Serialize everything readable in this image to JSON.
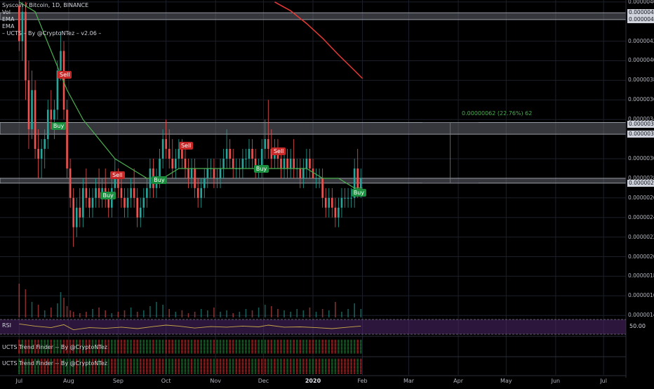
{
  "legend": {
    "title": "Syscoin / Bitcoin, 1D, BINANCE",
    "lines": [
      "Vol",
      "EMA",
      "EMA",
      "– UCTS – By @CryptoNTez – v2.06 –"
    ]
  },
  "panes": {
    "rsi_title": "RSI",
    "rsi_value": "50.00",
    "trend1_title": "UCTS Trend Finder -- By @CryptoNTez",
    "trend2_title": "UCTS Trend Finder -- By @CryptoNTez"
  },
  "measure_label": "0.00000062 (22.76%) 62",
  "colors": {
    "up": "#26a69a",
    "down": "#ef5350",
    "ema_fast": "#4caf50",
    "ema_slow": "#e53935",
    "rsi": "#c9a94a",
    "background": "#000000"
  },
  "chart_data": {
    "type": "candlestick",
    "title": "Syscoin / Bitcoin, 1D, BINANCE",
    "y_tick_labels": [
      "0.00000460",
      "0.00000442",
      "0.00000420",
      "0.00000400",
      "0.00000380",
      "0.00000360",
      "0.00000340",
      "0.00000325",
      "0.00000300",
      "0.00000280",
      "0.00000260",
      "0.00000240",
      "0.00000220",
      "0.00000200",
      "0.00000180",
      "0.00000160",
      "0.00000140"
    ],
    "y_ticks": [
      4.6e-06,
      4.42e-06,
      4.2e-06,
      4e-06,
      3.8e-06,
      3.6e-06,
      3.4e-06,
      3.25e-06,
      3e-06,
      2.8e-06,
      2.6e-06,
      2.4e-06,
      2.2e-06,
      2e-06,
      1.8e-06,
      1.6e-06,
      1.4e-06
    ],
    "price_labels": [
      {
        "text": "0.00000449",
        "value": 4.49e-06
      },
      {
        "text": "0.00000442",
        "value": 4.42e-06
      },
      {
        "text": "0.00000335",
        "value": 3.35e-06
      },
      {
        "text": "0.00000325",
        "value": 3.25e-06
      },
      {
        "text": "0.00000275",
        "value": 2.75e-06
      }
    ],
    "ylim": [
      1.38e-06,
      4.62e-06
    ],
    "x_labels": [
      {
        "text": "Jul",
        "day": 0
      },
      {
        "text": "Aug",
        "day": 31
      },
      {
        "text": "Sep",
        "day": 62
      },
      {
        "text": "Oct",
        "day": 92
      },
      {
        "text": "Nov",
        "day": 123
      },
      {
        "text": "Dec",
        "day": 153
      },
      {
        "text": "2020",
        "day": 184,
        "bold": true
      },
      {
        "text": "Feb",
        "day": 215
      },
      {
        "text": "Mar",
        "day": 244
      },
      {
        "text": "Apr",
        "day": 275
      },
      {
        "text": "May",
        "day": 305
      },
      {
        "text": "Jun",
        "day": 336
      },
      {
        "text": "Jul",
        "day": 366
      }
    ],
    "xlim": [
      -12,
      380
    ],
    "zones": [
      {
        "low": 4.42e-06,
        "high": 4.49e-06
      },
      {
        "low": 3.25e-06,
        "high": 3.37e-06
      },
      {
        "low": 2.75e-06,
        "high": 2.8e-06
      }
    ],
    "signals": [
      {
        "text": "Sell",
        "day": 28,
        "value": 3.85e-06,
        "kind": "sell"
      },
      {
        "text": "Buy",
        "day": 24,
        "value": 3.33e-06,
        "kind": "buy"
      },
      {
        "text": "Sell",
        "day": 61,
        "value": 2.83e-06,
        "kind": "sell"
      },
      {
        "text": "Buy",
        "day": 55,
        "value": 2.62e-06,
        "kind": "buy"
      },
      {
        "text": "Buy",
        "day": 87,
        "value": 2.78e-06,
        "kind": "buy"
      },
      {
        "text": "Sell",
        "day": 104,
        "value": 3.13e-06,
        "kind": "sell"
      },
      {
        "text": "Buy",
        "day": 151,
        "value": 2.89e-06,
        "kind": "buy"
      },
      {
        "text": "Sell",
        "day": 162,
        "value": 3.07e-06,
        "kind": "sell"
      },
      {
        "text": "Buy",
        "day": 212,
        "value": 2.65e-06,
        "kind": "buy"
      }
    ],
    "measure": {
      "day": 270,
      "from": 2.75e-06,
      "to": 3.37e-06
    },
    "ema_fast": [
      [
        0,
        4.6e-06
      ],
      [
        10,
        4.5e-06
      ],
      [
        20,
        4.1e-06
      ],
      [
        30,
        3.7e-06
      ],
      [
        40,
        3.4e-06
      ],
      [
        50,
        3.2e-06
      ],
      [
        60,
        3e-06
      ],
      [
        70,
        2.9e-06
      ],
      [
        80,
        2.8e-06
      ],
      [
        90,
        2.8e-06
      ],
      [
        100,
        2.9e-06
      ],
      [
        110,
        2.9e-06
      ],
      [
        120,
        2.9e-06
      ],
      [
        130,
        2.9e-06
      ],
      [
        140,
        2.9e-06
      ],
      [
        150,
        2.9e-06
      ],
      [
        160,
        2.9e-06
      ],
      [
        170,
        2.9e-06
      ],
      [
        180,
        2.9e-06
      ],
      [
        190,
        2.8e-06
      ],
      [
        200,
        2.8e-06
      ],
      [
        210,
        2.7e-06
      ],
      [
        215,
        2.7e-06
      ]
    ],
    "ema_slow": [
      [
        160,
        4.6e-06
      ],
      [
        170,
        4.51e-06
      ],
      [
        180,
        4.38e-06
      ],
      [
        190,
        4.23e-06
      ],
      [
        200,
        4.06e-06
      ],
      [
        210,
        3.9e-06
      ],
      [
        215,
        3.82e-06
      ]
    ],
    "candles": [
      [
        0,
        4.56e-06,
        4.62e-06,
        4.1e-06,
        4.2e-06
      ],
      [
        2,
        4.2e-06,
        4.6e-06,
        4e-06,
        4.5e-06
      ],
      [
        4,
        4.5e-06,
        4.6e-06,
        3.6e-06,
        3.8e-06
      ],
      [
        6,
        3.8e-06,
        4e-06,
        3.1e-06,
        3.3e-06
      ],
      [
        8,
        3.3e-06,
        3.9e-06,
        3.2e-06,
        3.7e-06
      ],
      [
        10,
        3.7e-06,
        3.8e-06,
        3e-06,
        3.1e-06
      ],
      [
        12,
        3.1e-06,
        3.3e-06,
        2.8e-06,
        3e-06
      ],
      [
        14,
        3e-06,
        3.2e-06,
        2.8e-06,
        3.1e-06
      ],
      [
        16,
        3.1e-06,
        3.3e-06,
        2.9e-06,
        3.2e-06
      ],
      [
        18,
        3.2e-06,
        3.6e-06,
        3.1e-06,
        3.5e-06
      ],
      [
        20,
        3.5e-06,
        3.7e-06,
        3.3e-06,
        3.4e-06
      ],
      [
        22,
        3.4e-06,
        3.6e-06,
        3.2e-06,
        3.5e-06
      ],
      [
        24,
        3.5e-06,
        4e-06,
        3.4e-06,
        3.9e-06
      ],
      [
        26,
        3.9e-06,
        4.3e-06,
        3.8e-06,
        4.1e-06
      ],
      [
        28,
        4.1e-06,
        4.2e-06,
        3.4e-06,
        3.5e-06
      ],
      [
        30,
        3.5e-06,
        3.6e-06,
        2.8e-06,
        2.9e-06
      ],
      [
        32,
        2.9e-06,
        3e-06,
        2.5e-06,
        2.6e-06
      ],
      [
        34,
        2.6e-06,
        2.7e-06,
        2.1e-06,
        2.3e-06
      ],
      [
        36,
        2.3e-06,
        2.6e-06,
        2.2e-06,
        2.5e-06
      ],
      [
        38,
        2.5e-06,
        2.7e-06,
        2.3e-06,
        2.4e-06
      ],
      [
        40,
        2.4e-06,
        2.8e-06,
        2.3e-06,
        2.7e-06
      ],
      [
        42,
        2.7e-06,
        2.9e-06,
        2.5e-06,
        2.6e-06
      ],
      [
        44,
        2.6e-06,
        2.7e-06,
        2.4e-06,
        2.5e-06
      ],
      [
        46,
        2.5e-06,
        2.7e-06,
        2.4e-06,
        2.6e-06
      ],
      [
        48,
        2.6e-06,
        2.8e-06,
        2.5e-06,
        2.7e-06
      ],
      [
        50,
        2.7e-06,
        2.9e-06,
        2.5e-06,
        2.6e-06
      ],
      [
        52,
        2.6e-06,
        2.8e-06,
        2.5e-06,
        2.7e-06
      ],
      [
        54,
        2.7e-06,
        2.9e-06,
        2.5e-06,
        2.6e-06
      ],
      [
        56,
        2.6e-06,
        2.7e-06,
        2.4e-06,
        2.5e-06
      ],
      [
        58,
        2.5e-06,
        2.8e-06,
        2.4e-06,
        2.7e-06
      ],
      [
        60,
        2.7e-06,
        3e-06,
        2.6e-06,
        2.8e-06
      ],
      [
        62,
        2.8e-06,
        2.9e-06,
        2.6e-06,
        2.7e-06
      ],
      [
        64,
        2.7e-06,
        2.8e-06,
        2.5e-06,
        2.6e-06
      ],
      [
        66,
        2.6e-06,
        2.7e-06,
        2.4e-06,
        2.5e-06
      ],
      [
        68,
        2.5e-06,
        2.7e-06,
        2.4e-06,
        2.6e-06
      ],
      [
        70,
        2.6e-06,
        2.8e-06,
        2.5e-06,
        2.7e-06
      ],
      [
        72,
        2.7e-06,
        2.9e-06,
        2.5e-06,
        2.6e-06
      ],
      [
        74,
        2.6e-06,
        2.7e-06,
        2.3e-06,
        2.4e-06
      ],
      [
        76,
        2.4e-06,
        2.6e-06,
        2.3e-06,
        2.5e-06
      ],
      [
        78,
        2.5e-06,
        2.7e-06,
        2.4e-06,
        2.6e-06
      ],
      [
        80,
        2.6e-06,
        2.8e-06,
        2.5e-06,
        2.7e-06
      ],
      [
        82,
        2.7e-06,
        3e-06,
        2.6e-06,
        2.9e-06
      ],
      [
        84,
        2.9e-06,
        3e-06,
        2.6e-06,
        2.7e-06
      ],
      [
        86,
        2.7e-06,
        2.9e-06,
        2.6e-06,
        2.8e-06
      ],
      [
        88,
        2.8e-06,
        3.1e-06,
        2.7e-06,
        3e-06
      ],
      [
        90,
        3e-06,
        3.3e-06,
        2.9e-06,
        3.2e-06
      ],
      [
        92,
        3.2e-06,
        3.4e-06,
        3e-06,
        3.1e-06
      ],
      [
        94,
        3.1e-06,
        3.3e-06,
        2.9e-06,
        3e-06
      ],
      [
        96,
        3e-06,
        3.2e-06,
        2.8e-06,
        2.9e-06
      ],
      [
        98,
        2.9e-06,
        3.1e-06,
        2.8e-06,
        3e-06
      ],
      [
        100,
        3e-06,
        3.2e-06,
        2.9e-06,
        3.1e-06
      ],
      [
        102,
        3.1e-06,
        3.2e-06,
        2.9e-06,
        3e-06
      ],
      [
        104,
        3e-06,
        3.1e-06,
        2.8e-06,
        2.9e-06
      ],
      [
        106,
        2.9e-06,
        3e-06,
        2.7e-06,
        2.8e-06
      ],
      [
        108,
        2.8e-06,
        3e-06,
        2.7e-06,
        2.9e-06
      ],
      [
        110,
        2.9e-06,
        3e-06,
        2.6e-06,
        2.7e-06
      ],
      [
        112,
        2.7e-06,
        2.8e-06,
        2.5e-06,
        2.6e-06
      ],
      [
        114,
        2.6e-06,
        2.8e-06,
        2.5e-06,
        2.7e-06
      ],
      [
        116,
        2.7e-06,
        2.9e-06,
        2.6e-06,
        2.8e-06
      ],
      [
        118,
        2.8e-06,
        3e-06,
        2.7e-06,
        2.9e-06
      ],
      [
        120,
        2.9e-06,
        3e-06,
        2.8e-06,
        2.9e-06
      ],
      [
        122,
        2.9e-06,
        3e-06,
        2.7e-06,
        2.8e-06
      ],
      [
        124,
        2.8e-06,
        2.9e-06,
        2.7e-06,
        2.8e-06
      ],
      [
        126,
        2.8e-06,
        3e-06,
        2.7e-06,
        2.9e-06
      ],
      [
        128,
        2.9e-06,
        3.1e-06,
        2.8e-06,
        3e-06
      ],
      [
        130,
        3e-06,
        3.3e-06,
        2.9e-06,
        3.1e-06
      ],
      [
        132,
        3.1e-06,
        3.2e-06,
        2.9e-06,
        3e-06
      ],
      [
        134,
        3e-06,
        3.1e-06,
        2.8e-06,
        2.9e-06
      ],
      [
        136,
        2.9e-06,
        3e-06,
        2.8e-06,
        2.9e-06
      ],
      [
        138,
        2.9e-06,
        3e-06,
        2.8e-06,
        2.9e-06
      ],
      [
        140,
        2.9e-06,
        3.1e-06,
        2.8e-06,
        3e-06
      ],
      [
        142,
        3e-06,
        3.1e-06,
        2.9e-06,
        3e-06
      ],
      [
        144,
        3e-06,
        3.2e-06,
        2.9e-06,
        3.1e-06
      ],
      [
        146,
        3.1e-06,
        3.2e-06,
        2.9e-06,
        3e-06
      ],
      [
        148,
        3e-06,
        3.1e-06,
        2.8e-06,
        2.9e-06
      ],
      [
        150,
        2.9e-06,
        3e-06,
        2.8e-06,
        2.9e-06
      ],
      [
        152,
        2.9e-06,
        3.2e-06,
        2.8e-06,
        3.1e-06
      ],
      [
        154,
        3.1e-06,
        3.4e-06,
        3e-06,
        3.2e-06
      ],
      [
        156,
        3.2e-06,
        3.6e-06,
        3e-06,
        3.1e-06
      ],
      [
        158,
        3.1e-06,
        3.3e-06,
        2.9e-06,
        3e-06
      ],
      [
        160,
        3e-06,
        3.2e-06,
        2.9e-06,
        3.1e-06
      ],
      [
        162,
        3.1e-06,
        3.2e-06,
        2.9e-06,
        3e-06
      ],
      [
        164,
        3e-06,
        3.1e-06,
        2.8e-06,
        2.9e-06
      ],
      [
        166,
        2.9e-06,
        3.1e-06,
        2.8e-06,
        3e-06
      ],
      [
        168,
        3e-06,
        3.1e-06,
        2.8e-06,
        2.9e-06
      ],
      [
        170,
        2.9e-06,
        3.1e-06,
        2.8e-06,
        3e-06
      ],
      [
        172,
        3e-06,
        3.2e-06,
        2.8e-06,
        2.9e-06
      ],
      [
        174,
        2.9e-06,
        3e-06,
        2.8e-06,
        2.9e-06
      ],
      [
        176,
        2.9e-06,
        3e-06,
        2.7e-06,
        2.8e-06
      ],
      [
        178,
        2.8e-06,
        3e-06,
        2.7e-06,
        2.9e-06
      ],
      [
        180,
        2.9e-06,
        3.1e-06,
        2.8e-06,
        3e-06
      ],
      [
        182,
        3e-06,
        3.1e-06,
        2.8e-06,
        2.9e-06
      ],
      [
        184,
        2.9e-06,
        3e-06,
        2.8e-06,
        2.8e-06
      ],
      [
        186,
        2.8e-06,
        2.9e-06,
        2.7e-06,
        2.8e-06
      ],
      [
        188,
        2.8e-06,
        2.9e-06,
        2.7e-06,
        2.8e-06
      ],
      [
        190,
        2.8e-06,
        2.9e-06,
        2.5e-06,
        2.6e-06
      ],
      [
        192,
        2.6e-06,
        2.7e-06,
        2.4e-06,
        2.5e-06
      ],
      [
        194,
        2.5e-06,
        2.7e-06,
        2.4e-06,
        2.6e-06
      ],
      [
        196,
        2.6e-06,
        2.7e-06,
        2.4e-06,
        2.5e-06
      ],
      [
        198,
        2.5e-06,
        2.6e-06,
        2.3e-06,
        2.4e-06
      ],
      [
        200,
        2.4e-06,
        2.6e-06,
        2.3e-06,
        2.5e-06
      ],
      [
        202,
        2.5e-06,
        2.7e-06,
        2.4e-06,
        2.6e-06
      ],
      [
        204,
        2.6e-06,
        2.7e-06,
        2.5e-06,
        2.6e-06
      ],
      [
        206,
        2.6e-06,
        2.7e-06,
        2.5e-06,
        2.6e-06
      ],
      [
        208,
        2.6e-06,
        2.7e-06,
        2.5e-06,
        2.6e-06
      ],
      [
        210,
        2.6e-06,
        3e-06,
        2.5e-06,
        2.9e-06
      ],
      [
        212,
        2.9e-06,
        3.1e-06,
        2.6e-06,
        2.7e-06
      ],
      [
        214,
        2.7e-06,
        2.9e-06,
        2.6e-06,
        2.8e-06
      ]
    ],
    "volume": [
      [
        0,
        48
      ],
      [
        4,
        40
      ],
      [
        8,
        22
      ],
      [
        12,
        18
      ],
      [
        16,
        10
      ],
      [
        20,
        14
      ],
      [
        24,
        20
      ],
      [
        26,
        36
      ],
      [
        28,
        28
      ],
      [
        30,
        16
      ],
      [
        32,
        10
      ],
      [
        34,
        8
      ],
      [
        38,
        6
      ],
      [
        42,
        8
      ],
      [
        46,
        12
      ],
      [
        50,
        14
      ],
      [
        54,
        10
      ],
      [
        58,
        6
      ],
      [
        62,
        8
      ],
      [
        66,
        10
      ],
      [
        70,
        14
      ],
      [
        74,
        8
      ],
      [
        78,
        10
      ],
      [
        82,
        16
      ],
      [
        86,
        22
      ],
      [
        90,
        18
      ],
      [
        94,
        12
      ],
      [
        98,
        8
      ],
      [
        102,
        10
      ],
      [
        106,
        6
      ],
      [
        110,
        8
      ],
      [
        114,
        12
      ],
      [
        118,
        10
      ],
      [
        122,
        14
      ],
      [
        126,
        8
      ],
      [
        130,
        10
      ],
      [
        134,
        6
      ],
      [
        138,
        8
      ],
      [
        142,
        12
      ],
      [
        146,
        10
      ],
      [
        150,
        14
      ],
      [
        154,
        18
      ],
      [
        158,
        16
      ],
      [
        162,
        12
      ],
      [
        166,
        10
      ],
      [
        170,
        8
      ],
      [
        174,
        12
      ],
      [
        178,
        10
      ],
      [
        182,
        14
      ],
      [
        186,
        8
      ],
      [
        190,
        12
      ],
      [
        194,
        10
      ],
      [
        198,
        22
      ],
      [
        202,
        8
      ],
      [
        206,
        12
      ],
      [
        210,
        20
      ],
      [
        214,
        12
      ]
    ],
    "rsi": [
      [
        0,
        70
      ],
      [
        10,
        55
      ],
      [
        20,
        45
      ],
      [
        28,
        65
      ],
      [
        34,
        30
      ],
      [
        44,
        45
      ],
      [
        54,
        40
      ],
      [
        64,
        48
      ],
      [
        74,
        38
      ],
      [
        84,
        52
      ],
      [
        92,
        62
      ],
      [
        100,
        55
      ],
      [
        110,
        42
      ],
      [
        120,
        52
      ],
      [
        130,
        48
      ],
      [
        140,
        55
      ],
      [
        150,
        50
      ],
      [
        156,
        62
      ],
      [
        166,
        48
      ],
      [
        176,
        50
      ],
      [
        186,
        45
      ],
      [
        196,
        38
      ],
      [
        206,
        48
      ],
      [
        214,
        55
      ]
    ],
    "rsi_range": [
      0,
      100
    ],
    "rsi_mid": 50
  }
}
